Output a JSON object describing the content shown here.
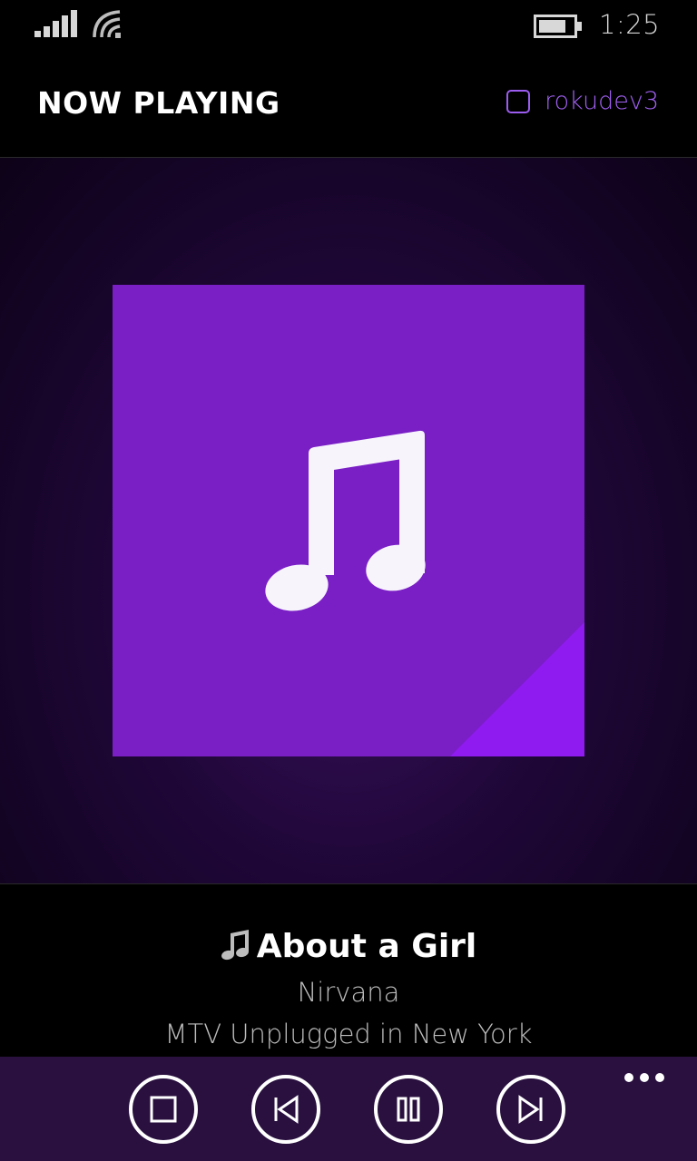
{
  "status_bar": {
    "time": "1:25",
    "icons": [
      "signal-icon",
      "wifi-icon",
      "battery-icon"
    ]
  },
  "header": {
    "title": "NOW PLAYING",
    "device_name": "rokudev3",
    "device_selected": false
  },
  "now_playing": {
    "album_art_icon": "music-note-icon",
    "track_icon": "music-note-icon",
    "title": "About a Girl",
    "artist": "Nirvana",
    "album": "MTV Unplugged in New York"
  },
  "controls": [
    {
      "name": "stop",
      "icon": "stop-icon"
    },
    {
      "name": "previous",
      "icon": "skip-previous-icon"
    },
    {
      "name": "pause",
      "icon": "pause-icon"
    },
    {
      "name": "next",
      "icon": "skip-next-icon"
    }
  ],
  "colors": {
    "accent": "#9c5cf0",
    "album_tile": "#7a1ec6",
    "album_corner": "#8f1bf0",
    "app_bar": "#29103f",
    "background": "#000000"
  }
}
